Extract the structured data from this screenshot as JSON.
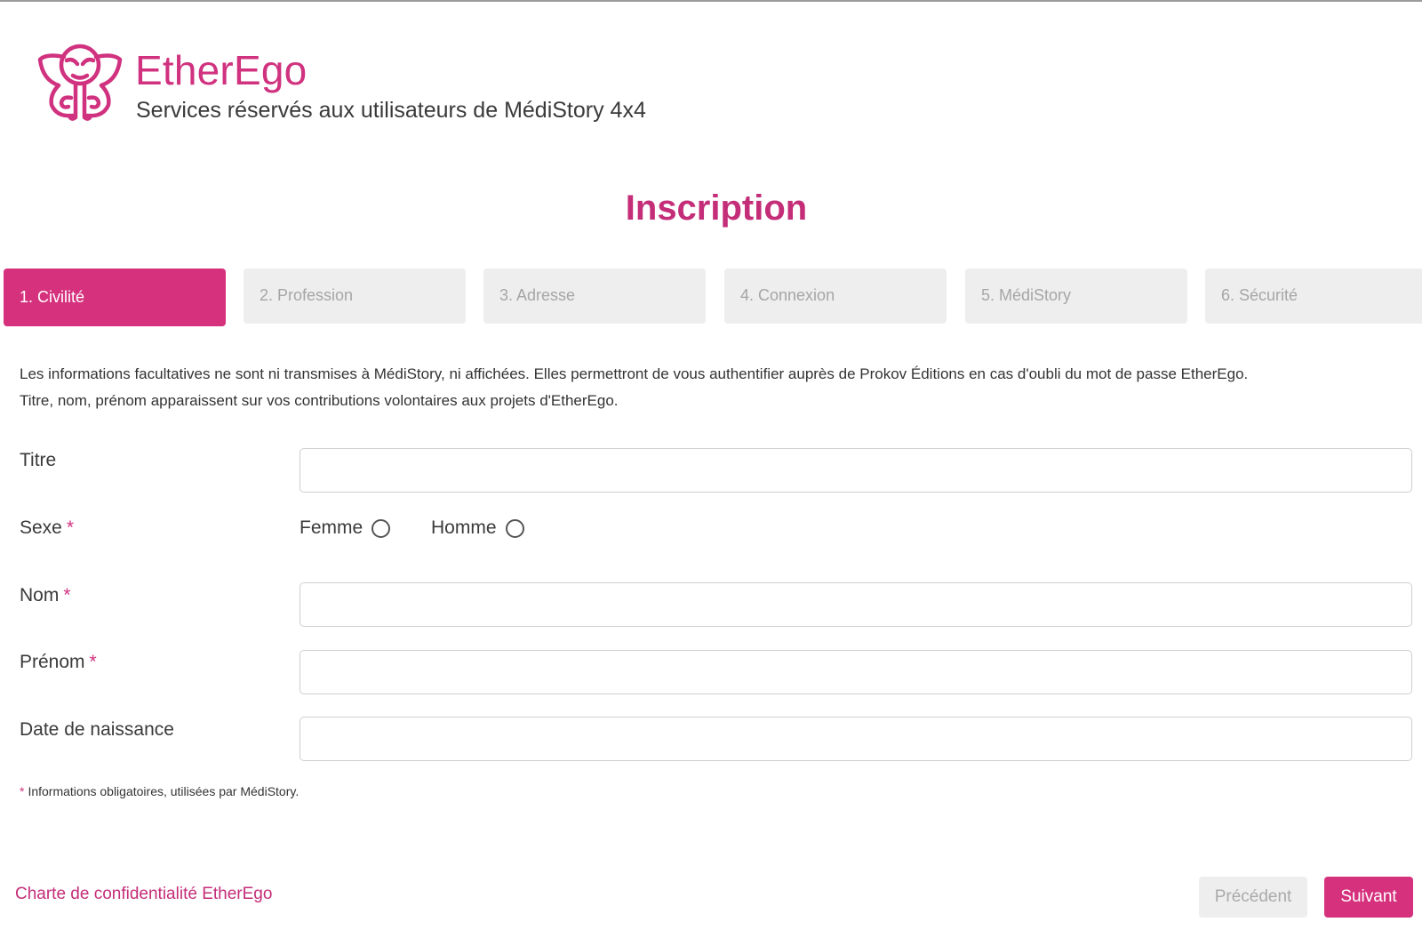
{
  "header": {
    "brand_name": "EtherEgo",
    "tagline": "Services réservés aux utilisateurs de MédiStory 4x4",
    "logo_icon": "butterfly-face-logo-icon"
  },
  "page_title": "Inscription",
  "steps": [
    {
      "label": "1. Civilité",
      "active": true
    },
    {
      "label": "2. Profession",
      "active": false
    },
    {
      "label": "3. Adresse",
      "active": false
    },
    {
      "label": "4. Connexion",
      "active": false
    },
    {
      "label": "5. MédiStory",
      "active": false
    },
    {
      "label": "6. Sécurité",
      "active": false
    }
  ],
  "intro": {
    "line1": "Les informations facultatives ne sont ni transmises à MédiStory, ni affichées. Elles permettront de vous authentifier auprès de Prokov Éditions en cas d'oubli du mot de passe EtherEgo.",
    "line2": "Titre, nom, prénom apparaissent sur vos contributions volontaires aux projets d'EtherEgo."
  },
  "form": {
    "titre": {
      "label": "Titre",
      "value": "",
      "required": false
    },
    "sexe": {
      "label": "Sexe",
      "required": true,
      "options": [
        {
          "label": "Femme",
          "selected": false
        },
        {
          "label": "Homme",
          "selected": false
        }
      ]
    },
    "nom": {
      "label": "Nom",
      "value": "",
      "required": true
    },
    "prenom": {
      "label": "Prénom",
      "value": "",
      "required": true
    },
    "naissance": {
      "label": "Date de naissance",
      "value": "",
      "required": false
    },
    "required_marker": "*"
  },
  "footnote": {
    "marker": "*",
    "text": "Informations obligatoires, utilisées par MédiStory."
  },
  "footer": {
    "privacy_link": "Charte de confidentialité EtherEgo",
    "prev_label": "Précédent",
    "next_label": "Suivant"
  },
  "colors": {
    "accent": "#d5317d",
    "inactive_step_bg": "#eeeeee",
    "inactive_step_text": "#a6a6a6"
  }
}
